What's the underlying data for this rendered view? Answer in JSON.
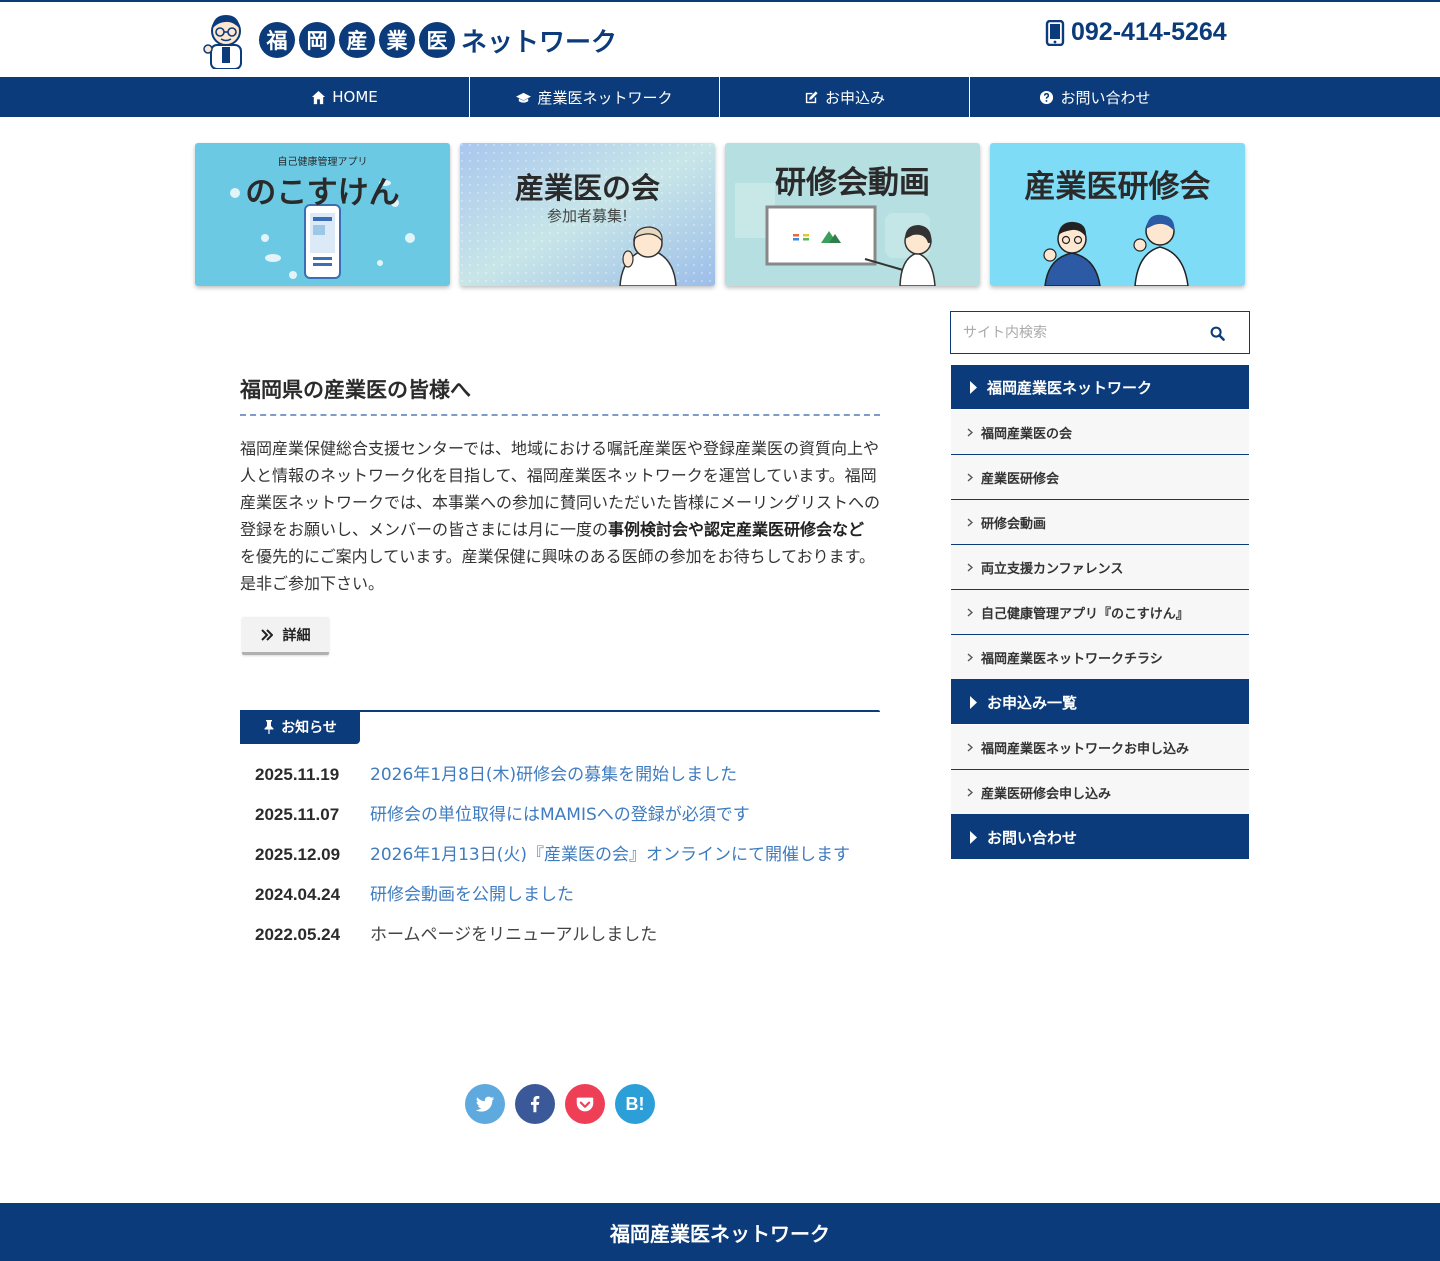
{
  "header": {
    "logo_chars": [
      "福",
      "岡",
      "産",
      "業",
      "医"
    ],
    "logo_tail": "ネットワーク",
    "phone": "092-414-5264"
  },
  "nav": {
    "items": [
      {
        "label": "HOME",
        "icon": "home-icon"
      },
      {
        "label": "産業医ネットワーク",
        "icon": "graduation-cap-icon"
      },
      {
        "label": "お申込み",
        "icon": "edit-icon"
      },
      {
        "label": "お問い合わせ",
        "icon": "question-circle-icon"
      }
    ]
  },
  "banners": [
    {
      "subtitle": "自己健康管理アプリ",
      "title": "のこすけん"
    },
    {
      "title": "産業医の会",
      "subtitle": "参加者募集!"
    },
    {
      "title": "研修会動画"
    },
    {
      "title": "産業医研修会"
    }
  ],
  "main": {
    "section_title": "福岡県の産業医の皆様へ",
    "intro_before": "福岡産業保健総合支援センターでは、地域における嘱託産業医や登録産業医の資質向上や人と情報のネットワーク化を目指して、福岡産業医ネットワークを運営しています。福岡産業医ネットワークでは、本事業への参加に賛同いただいた皆様にメーリングリストへの登録をお願いし、メンバーの皆さまには月に一度の",
    "intro_bold": "事例検討会や認定産業医研修会など",
    "intro_after": "を優先的にご案内しています。産業保健に興味のある医師の参加をお待ちしております。是非ご参加下さい。",
    "detail_button": "詳細"
  },
  "news": {
    "tab_label": "お知らせ",
    "items": [
      {
        "date": "2025.11.19",
        "text": "2026年1月8日(木)研修会の募集を開始しました",
        "link": true
      },
      {
        "date": "2025.11.07",
        "text": "研修会の単位取得にはMAMISへの登録が必須です",
        "link": true
      },
      {
        "date": "2025.12.09",
        "text": "2026年1月13日(火)『産業医の会』オンラインにて開催します",
        "link": true
      },
      {
        "date": "2024.04.24",
        "text": "研修会動画を公開しました",
        "link": true
      },
      {
        "date": "2022.05.24",
        "text": "ホームページをリニューアルしました",
        "link": false
      }
    ]
  },
  "share": {
    "twitter_color": "#5ea9dd",
    "facebook_color": "#3b5998",
    "pocket_color": "#ef3f56",
    "hatena_color": "#2c9fd8",
    "hatena_label": "B!"
  },
  "sidebar": {
    "search_placeholder": "サイト内検索",
    "groups": [
      {
        "title": "福岡産業医ネットワーク",
        "items": [
          "福岡産業医の会",
          "産業医研修会",
          "研修会動画",
          "両立支援カンファレンス",
          "自己健康管理アプリ『のこすけん』",
          "福岡産業医ネットワークチラシ"
        ]
      },
      {
        "title": "お申込み一覧",
        "items": [
          "福岡産業医ネットワークお申し込み",
          "産業医研修会申し込み"
        ]
      },
      {
        "title": "お問い合わせ",
        "items": []
      }
    ]
  },
  "footer": {
    "title": "福岡産業医ネットワーク"
  },
  "colors": {
    "brand": "#0b3b7a",
    "link": "#3f7cc0"
  }
}
